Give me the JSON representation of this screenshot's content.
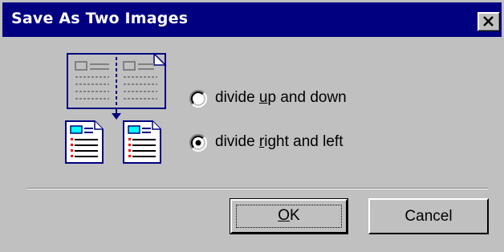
{
  "window": {
    "title": "Save As Two Images"
  },
  "titlebar": {
    "close_icon": "close-x-icon"
  },
  "illustration": {
    "icon": "split-document-into-two-pages-icon"
  },
  "options": [
    {
      "prefix": "divide ",
      "accel": "u",
      "suffix": "p and down",
      "selected": false
    },
    {
      "prefix": "divide ",
      "accel": "r",
      "suffix": "ight and left",
      "selected": true
    }
  ],
  "buttons": {
    "ok_label": "OK",
    "ok_accel": "O",
    "ok_rest": "K",
    "cancel_label": "Cancel"
  },
  "colors": {
    "titlebar": "#000080",
    "face": "#c0c0c0",
    "doc_blue": "#000080",
    "doc_cyan": "#00ffff",
    "doc_red": "#ff0000"
  }
}
